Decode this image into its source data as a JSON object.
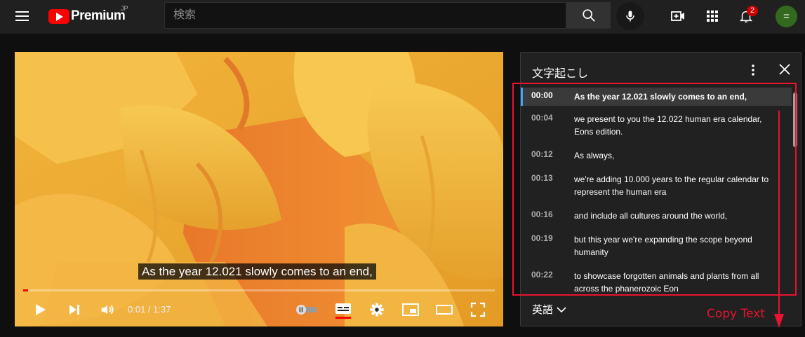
{
  "colors": {
    "accent_red": "#ff0000",
    "highlight": "#e8132f",
    "active_bar": "#3ea6ff"
  },
  "header": {
    "logo_text": "Premium",
    "logo_region": "JP",
    "search_placeholder": "検索",
    "notification_count": "2",
    "avatar_letter": "=",
    "icons": [
      "menu-icon",
      "search-icon",
      "mic-icon",
      "create-icon",
      "apps-icon",
      "bell-icon"
    ]
  },
  "player": {
    "caption": "As the year 12.021 slowly comes to an end,",
    "time_display": "0:01 / 1:37",
    "progress_fraction": 0.01,
    "icons": [
      "play-icon",
      "next-icon",
      "volume-icon",
      "autoplay-toggle-icon",
      "subtitles-icon",
      "settings-icon",
      "miniplayer-icon",
      "theater-icon",
      "fullscreen-icon"
    ]
  },
  "transcript": {
    "title": "文字起こし",
    "language": "英語",
    "segments": [
      {
        "time": "00:00",
        "text": "As the year 12.021 slowly comes to an end,",
        "active": true
      },
      {
        "time": "00:04",
        "text": "we present to you the 12.022 human era calendar, Eons edition."
      },
      {
        "time": "00:12",
        "text": "As always,"
      },
      {
        "time": "00:13",
        "text": "we're adding 10.000 years to the regular calendar to represent the human era"
      },
      {
        "time": "00:16",
        "text": "and include all cultures around the world,"
      },
      {
        "time": "00:19",
        "text": "but this year we're expanding the scope beyond humanity"
      },
      {
        "time": "00:22",
        "text": "to showcase forgotten animals and plants from all across the phanerozoic Eon"
      }
    ]
  },
  "annotation": {
    "label": "Copy Text"
  }
}
